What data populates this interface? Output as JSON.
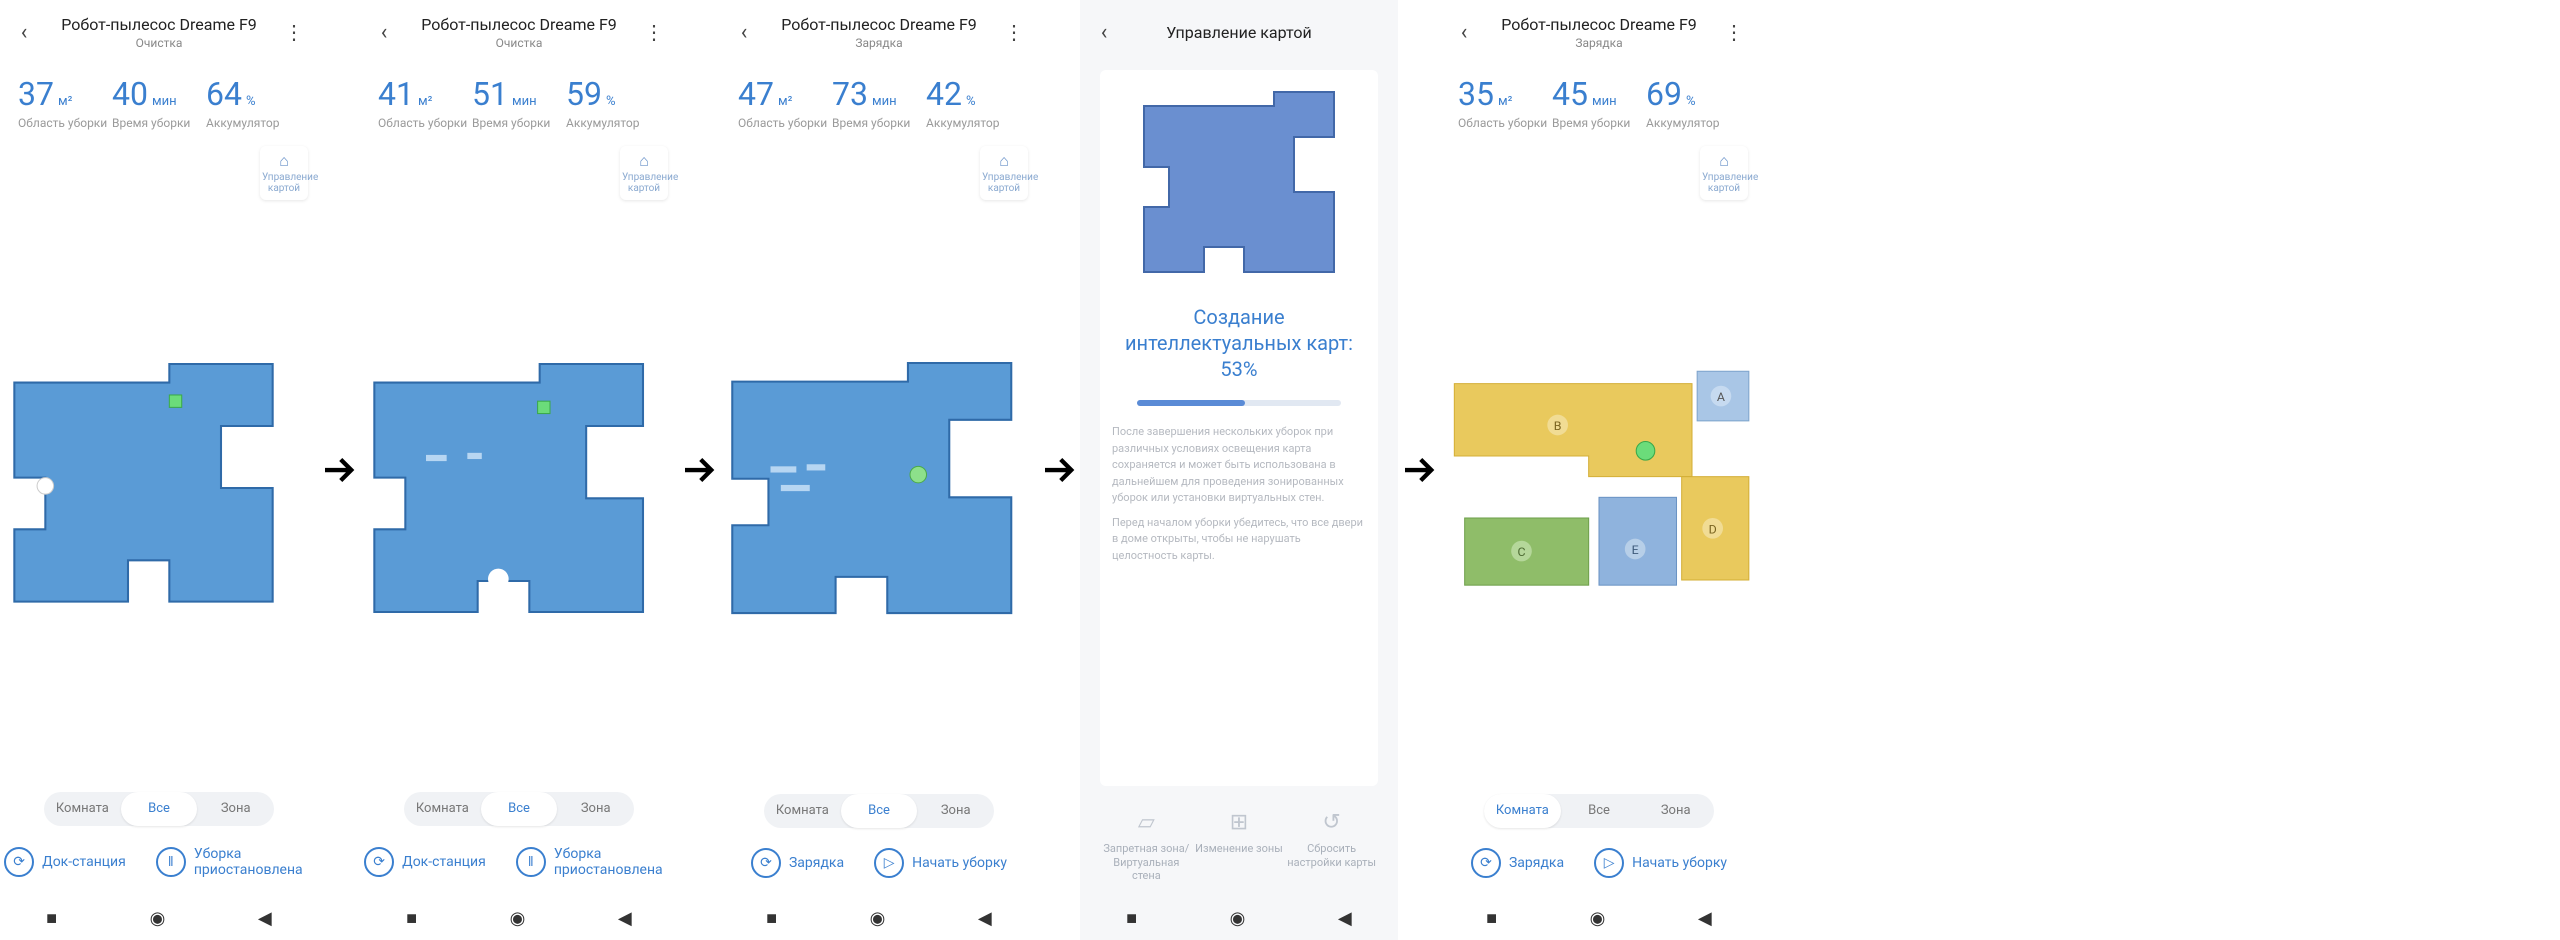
{
  "colors": {
    "accent": "#3a7fcf",
    "map_fill": "#5a9bd6",
    "map_fill_dark": "#6a8fd0"
  },
  "screens": [
    {
      "title": "Робот-пылесос Dreame F9",
      "subtitle": "Очистка",
      "stats": {
        "area": "37",
        "area_unit": "м²",
        "area_label": "Область уборки",
        "time": "40",
        "time_unit": "мин",
        "time_label": "Время уборки",
        "batt": "64",
        "batt_unit": "%",
        "batt_label": "Аккумулятор"
      },
      "map_button": "Управление картой",
      "tabs": [
        "Комната",
        "Все",
        "Зона"
      ],
      "tab_active": 1,
      "actions": [
        {
          "icon": "⟳",
          "label": "Док-станция"
        },
        {
          "icon": "‖",
          "label": "Уборка приостановлена"
        }
      ]
    },
    {
      "title": "Робот-пылесос Dreame F9",
      "subtitle": "Очистка",
      "stats": {
        "area": "41",
        "area_unit": "м²",
        "area_label": "Область уборки",
        "time": "51",
        "time_unit": "мин",
        "time_label": "Время уборки",
        "batt": "59",
        "batt_unit": "%",
        "batt_label": "Аккумулятор"
      },
      "map_button": "Управление картой",
      "tabs": [
        "Комната",
        "Все",
        "Зона"
      ],
      "tab_active": 1,
      "actions": [
        {
          "icon": "⟳",
          "label": "Док-станция"
        },
        {
          "icon": "‖",
          "label": "Уборка приостановлена"
        }
      ]
    },
    {
      "title": "Робот-пылесос Dreame F9",
      "subtitle": "Зарядка",
      "stats": {
        "area": "47",
        "area_unit": "м²",
        "area_label": "Область уборки",
        "time": "73",
        "time_unit": "мин",
        "time_label": "Время уборки",
        "batt": "42",
        "batt_unit": "%",
        "batt_label": "Аккумулятор"
      },
      "map_button": "Управление картой",
      "tabs": [
        "Комната",
        "Все",
        "Зона"
      ],
      "tab_active": 1,
      "actions": [
        {
          "icon": "⟳",
          "label": "Зарядка"
        },
        {
          "icon": "▷",
          "label": "Начать уборку"
        }
      ]
    },
    {
      "title": "Управление картой",
      "mm_prog_text_prefix": "Создание интеллектуальных карт: ",
      "mm_prog_percent": 53,
      "mm_desc1": "После завершения нескольких уборок при различных условиях освещения карта сохраняется и может быть использована в дальнейшем для проведения зонированных уборок или установки виртуальных стен.",
      "mm_desc2": "Перед началом уборки убедитесь, что все двери в доме открыты, чтобы не нарушать целостность карты.",
      "tools": [
        {
          "icon": "▱",
          "label": "Запретная зона/ Виртуальная стена"
        },
        {
          "icon": "⊞",
          "label": "Изменение зоны"
        },
        {
          "icon": "↺",
          "label": "Сбросить настройки карты"
        }
      ]
    },
    {
      "title": "Робот-пылесос Dreame F9",
      "subtitle": "Зарядка",
      "stats": {
        "area": "35",
        "area_unit": "м²",
        "area_label": "Область уборки",
        "time": "45",
        "time_unit": "мин",
        "time_label": "Время уборки",
        "batt": "69",
        "batt_unit": "%",
        "batt_label": "Аккумулятор"
      },
      "map_button": "Управление картой",
      "tabs": [
        "Комната",
        "Все",
        "Зона"
      ],
      "tab_active": 0,
      "actions": [
        {
          "icon": "⟳",
          "label": "Зарядка"
        },
        {
          "icon": "▷",
          "label": "Начать уборку"
        }
      ],
      "rooms": [
        "A",
        "B",
        "C",
        "D",
        "E"
      ]
    }
  ]
}
